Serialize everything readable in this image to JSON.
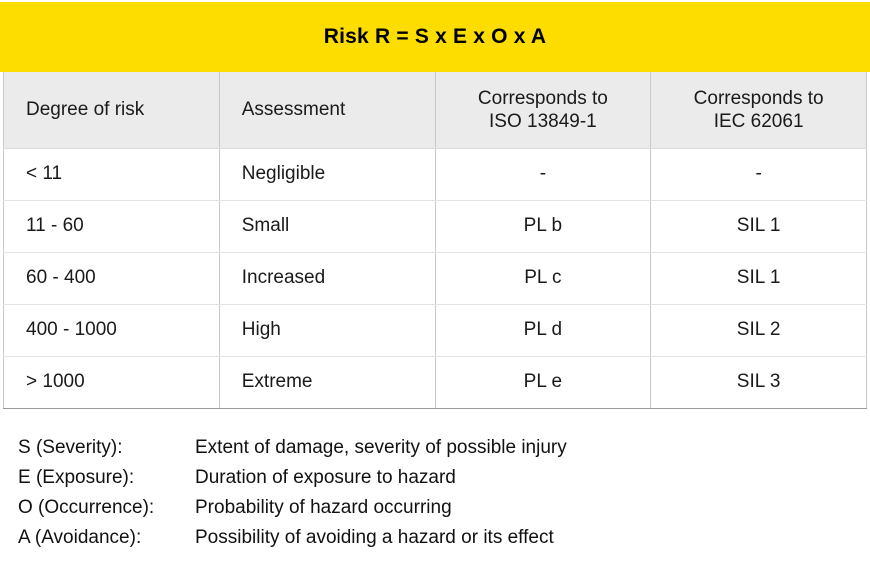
{
  "banner": {
    "title": "Risk R = S x E x O x A",
    "background_color": "#FDDD00",
    "text_color": "#000000"
  },
  "table": {
    "header_background": "#EBEBEB",
    "columns": [
      {
        "key": "degree",
        "label": "Degree of risk"
      },
      {
        "key": "assessment",
        "label": "Assessment"
      },
      {
        "key": "iso",
        "label": "Corresponds to ISO 13849-1",
        "line1": "Corresponds to",
        "line2": "ISO 13849-1"
      },
      {
        "key": "iec",
        "label": "Corresponds to IEC 62061",
        "line1": "Corresponds to",
        "line2": "IEC 62061"
      }
    ],
    "rows": [
      {
        "degree": "< 11",
        "assessment": "Negligible",
        "iso": "-",
        "iec": "-"
      },
      {
        "degree": "11 - 60",
        "assessment": "Small",
        "iso": "PL b",
        "iec": "SIL 1"
      },
      {
        "degree": "60 - 400",
        "assessment": "Increased",
        "iso": "PL c",
        "iec": "SIL 1"
      },
      {
        "degree": "400 - 1000",
        "assessment": "High",
        "iso": "PL d",
        "iec": "SIL 2"
      },
      {
        "degree": "> 1000",
        "assessment": "Extreme",
        "iso": "PL e",
        "iec": "SIL 3"
      }
    ]
  },
  "legend": {
    "items": [
      {
        "term": "S (Severity):",
        "description": "Extent of damage, severity of possible injury"
      },
      {
        "term": "E (Exposure):",
        "description": "Duration of exposure to hazard"
      },
      {
        "term": "O (Occurrence):",
        "description": "Probability of hazard occurring"
      },
      {
        "term": "A (Avoidance):",
        "description": "Possibility of avoiding a hazard or its effect"
      }
    ]
  }
}
